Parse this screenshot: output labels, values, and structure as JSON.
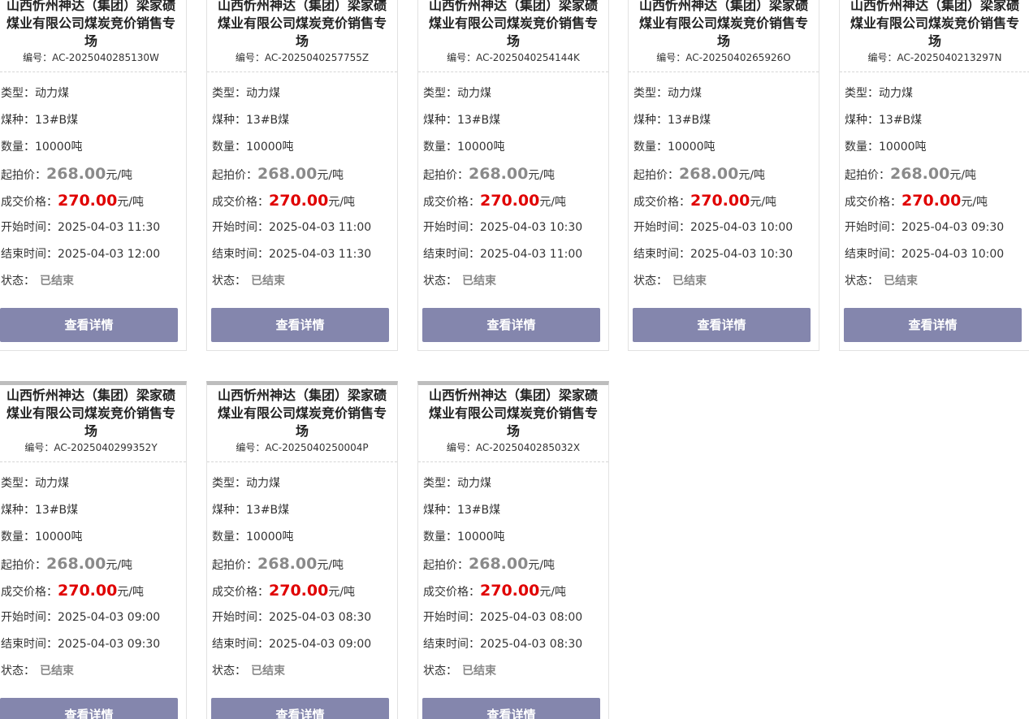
{
  "labels": {
    "code_prefix": "编号：",
    "type": "类型：",
    "coal_kind": "煤种：",
    "quantity": "数量：",
    "start_price": "起拍价：",
    "deal_price": "成交价格：",
    "unit": "元/吨",
    "start_time": "开始时间：",
    "end_time": "结束时间：",
    "status": "状态：",
    "detail_button": "查看详情"
  },
  "cards": [
    {
      "title": "山西忻州神达（集团）梁家碛煤业有限公司煤炭竞价销售专场",
      "code": "AC-2025040285130W",
      "type": "动力煤",
      "coal_kind": "13#B煤",
      "quantity": "10000吨",
      "start_price": "268.00",
      "deal_price": "270.00",
      "start_time": "2025-04-03 11:30",
      "end_time": "2025-04-03 12:00",
      "status": "已结束"
    },
    {
      "title": "山西忻州神达（集团）梁家碛煤业有限公司煤炭竞价销售专场",
      "code": "AC-2025040257755Z",
      "type": "动力煤",
      "coal_kind": "13#B煤",
      "quantity": "10000吨",
      "start_price": "268.00",
      "deal_price": "270.00",
      "start_time": "2025-04-03 11:00",
      "end_time": "2025-04-03 11:30",
      "status": "已结束"
    },
    {
      "title": "山西忻州神达（集团）梁家碛煤业有限公司煤炭竞价销售专场",
      "code": "AC-2025040254144K",
      "type": "动力煤",
      "coal_kind": "13#B煤",
      "quantity": "10000吨",
      "start_price": "268.00",
      "deal_price": "270.00",
      "start_time": "2025-04-03 10:30",
      "end_time": "2025-04-03 11:00",
      "status": "已结束"
    },
    {
      "title": "山西忻州神达（集团）梁家碛煤业有限公司煤炭竞价销售专场",
      "code": "AC-2025040265926O",
      "type": "动力煤",
      "coal_kind": "13#B煤",
      "quantity": "10000吨",
      "start_price": "268.00",
      "deal_price": "270.00",
      "start_time": "2025-04-03 10:00",
      "end_time": "2025-04-03 10:30",
      "status": "已结束"
    },
    {
      "title": "山西忻州神达（集团）梁家碛煤业有限公司煤炭竞价销售专场",
      "code": "AC-2025040213297N",
      "type": "动力煤",
      "coal_kind": "13#B煤",
      "quantity": "10000吨",
      "start_price": "268.00",
      "deal_price": "270.00",
      "start_time": "2025-04-03 09:30",
      "end_time": "2025-04-03 10:00",
      "status": "已结束"
    },
    {
      "title": "山西忻州神达（集团）梁家碛煤业有限公司煤炭竞价销售专场",
      "code": "AC-2025040299352Y",
      "type": "动力煤",
      "coal_kind": "13#B煤",
      "quantity": "10000吨",
      "start_price": "268.00",
      "deal_price": "270.00",
      "start_time": "2025-04-03 09:00",
      "end_time": "2025-04-03 09:30",
      "status": "已结束"
    },
    {
      "title": "山西忻州神达（集团）梁家碛煤业有限公司煤炭竞价销售专场",
      "code": "AC-2025040250004P",
      "type": "动力煤",
      "coal_kind": "13#B煤",
      "quantity": "10000吨",
      "start_price": "268.00",
      "deal_price": "270.00",
      "start_time": "2025-04-03 08:30",
      "end_time": "2025-04-03 09:00",
      "status": "已结束"
    },
    {
      "title": "山西忻州神达（集团）梁家碛煤业有限公司煤炭竞价销售专场",
      "code": "AC-2025040285032X",
      "type": "动力煤",
      "coal_kind": "13#B煤",
      "quantity": "10000吨",
      "start_price": "268.00",
      "deal_price": "270.00",
      "start_time": "2025-04-03 08:00",
      "end_time": "2025-04-03 08:30",
      "status": "已结束"
    }
  ]
}
